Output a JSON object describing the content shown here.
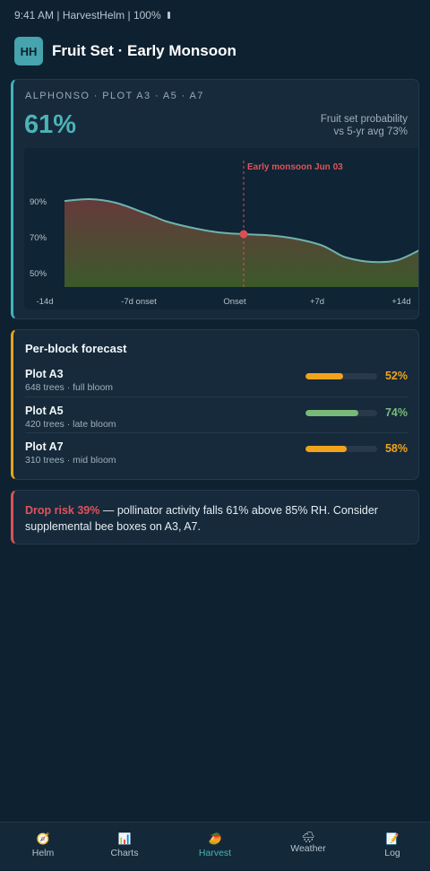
{
  "status_bar": {
    "text": "9:41 AM | HarvestHelm | 100%"
  },
  "header": {
    "logo": "HH",
    "title": "Fruit Set · Early Monsoon"
  },
  "probability_card": {
    "meta": "ALPHONSO · PLOT A3 · A5 · A7",
    "value": "61%",
    "caption_line1": "Fruit set probability",
    "caption_line2": "vs 5-yr avg 73%",
    "accent_color": "#3fb4bc"
  },
  "chart_data": {
    "type": "area",
    "x": [
      -14,
      -12,
      -10,
      -8,
      -7,
      -6,
      -4,
      -2,
      0,
      2,
      4,
      6,
      7,
      8,
      10,
      12,
      14
    ],
    "values": [
      90.5,
      91.5,
      89.5,
      84.5,
      81.8,
      79,
      75.5,
      73,
      72,
      71.3,
      69.5,
      66,
      62.5,
      59,
      56.5,
      57.5,
      64
    ],
    "ylim": [
      40,
      100
    ],
    "y_ticks": [
      "90%",
      "70%",
      "50%"
    ],
    "x_ticks": [
      "-14d",
      "-7d onset",
      "Onset",
      "+7d",
      "+14d"
    ],
    "annotation": {
      "label": "Early monsoon Jun 03",
      "x": 0,
      "y": 72
    },
    "grid": false,
    "fill_top_color": "#6a3b3d",
    "fill_bottom_color": "#3e5c2a",
    "line_color": "#6fb3ad"
  },
  "blocks": {
    "heading": "Per-block forecast",
    "plots": [
      {
        "name": "Plot A3",
        "detail": "648 trees · full bloom",
        "percent": "52%",
        "value": 0.52,
        "color": "#f0a41c"
      },
      {
        "name": "Plot A5",
        "detail": "420 trees · late bloom",
        "percent": "74%",
        "value": 0.74,
        "color": "#79b978"
      },
      {
        "name": "Plot A7",
        "detail": "310 trees · mid bloom",
        "percent": "58%",
        "value": 0.58,
        "color": "#f0a41c"
      }
    ]
  },
  "risk": {
    "highlight": "Drop risk 39%",
    "text": " — pollinator activity falls 61% above 85% RH. Consider supplemental bee boxes on A3, A7."
  },
  "nav": {
    "active": "Harvest",
    "items": [
      {
        "label": "Helm",
        "icon": "compass-icon"
      },
      {
        "label": "Charts",
        "icon": "bar-chart-icon"
      },
      {
        "label": "Harvest",
        "icon": "mango-icon"
      },
      {
        "label": "Weather",
        "icon": "rain-cloud-icon"
      },
      {
        "label": "Log",
        "icon": "notepad-icon"
      }
    ]
  }
}
